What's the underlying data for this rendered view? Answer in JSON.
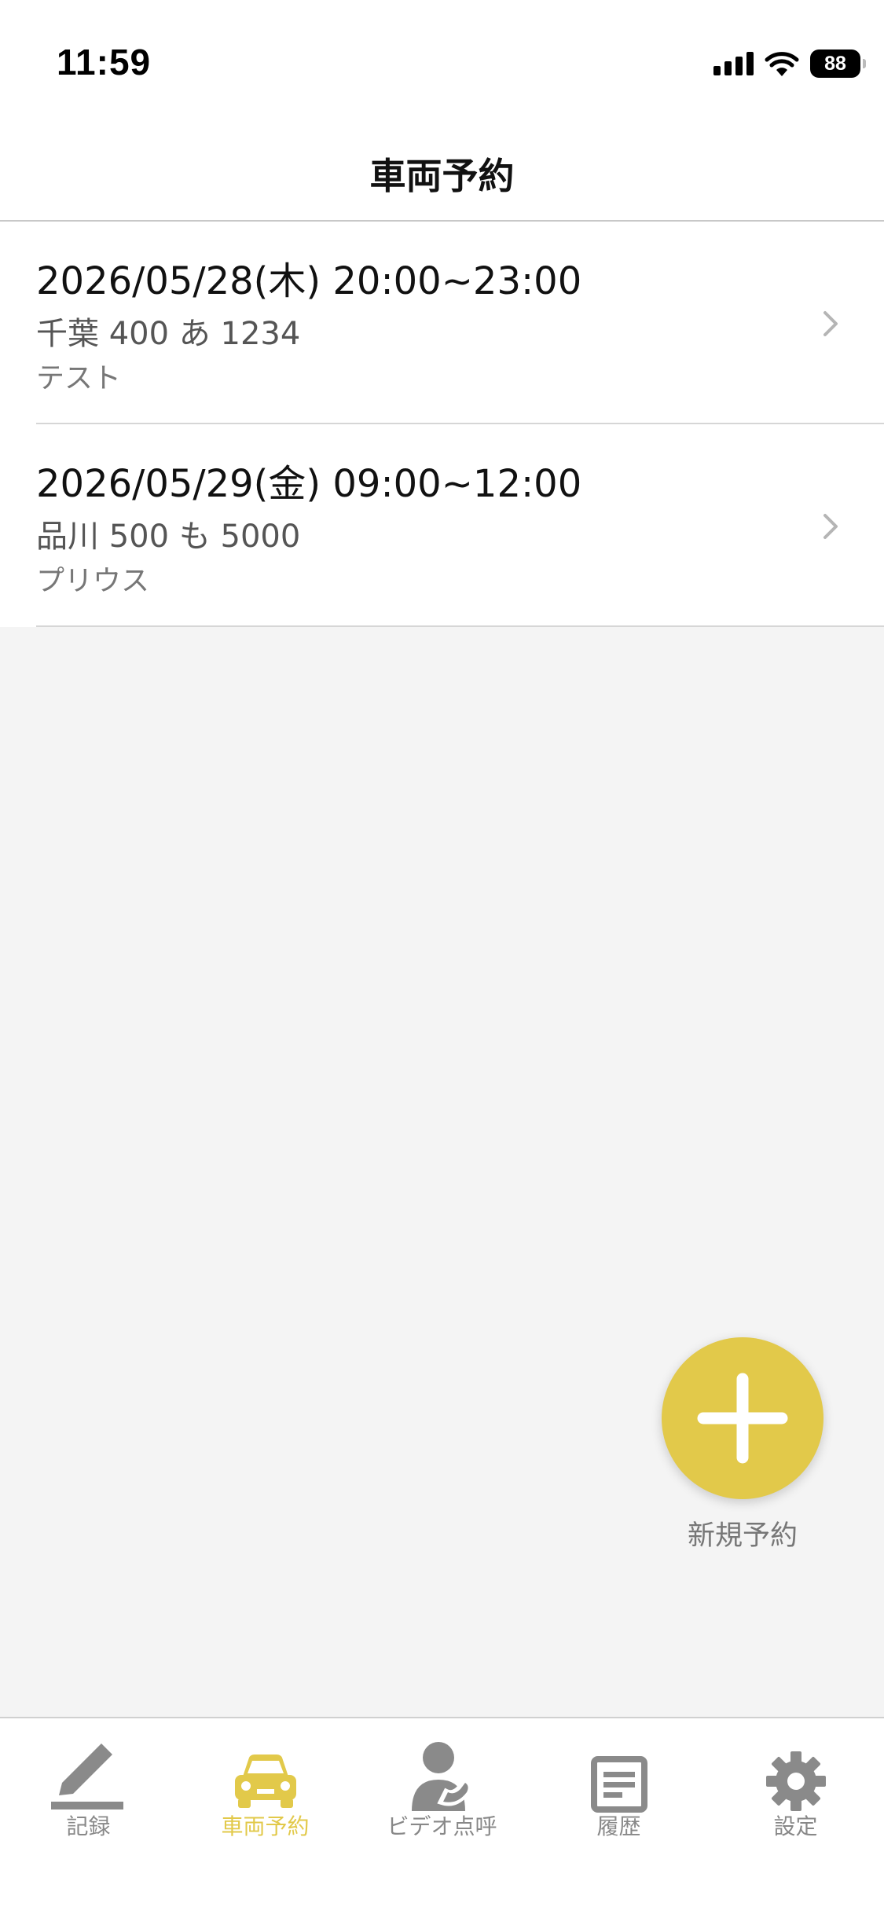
{
  "status_bar": {
    "time": "11:59",
    "battery": "88"
  },
  "nav": {
    "title": "車両予約"
  },
  "reservations": [
    {
      "datetime": "2026/05/28(木) 20:00~23:00",
      "plate": "千葉 400 あ 1234",
      "car": "テスト"
    },
    {
      "datetime": "2026/05/29(金) 09:00~12:00",
      "plate": "品川 500 も 5000",
      "car": "プリウス"
    }
  ],
  "fab": {
    "label": "新規予約"
  },
  "tabs": [
    {
      "label": "記録",
      "icon": "pencil-icon",
      "active": false
    },
    {
      "label": "車両予約",
      "icon": "car-icon",
      "active": true
    },
    {
      "label": "ビデオ点呼",
      "icon": "person-phone-icon",
      "active": false
    },
    {
      "label": "履歴",
      "icon": "document-icon",
      "active": false
    },
    {
      "label": "設定",
      "icon": "gear-icon",
      "active": false
    }
  ],
  "colors": {
    "accent": "#e2c94a",
    "inactive": "#8a8a8a",
    "background": "#f4f4f4"
  }
}
